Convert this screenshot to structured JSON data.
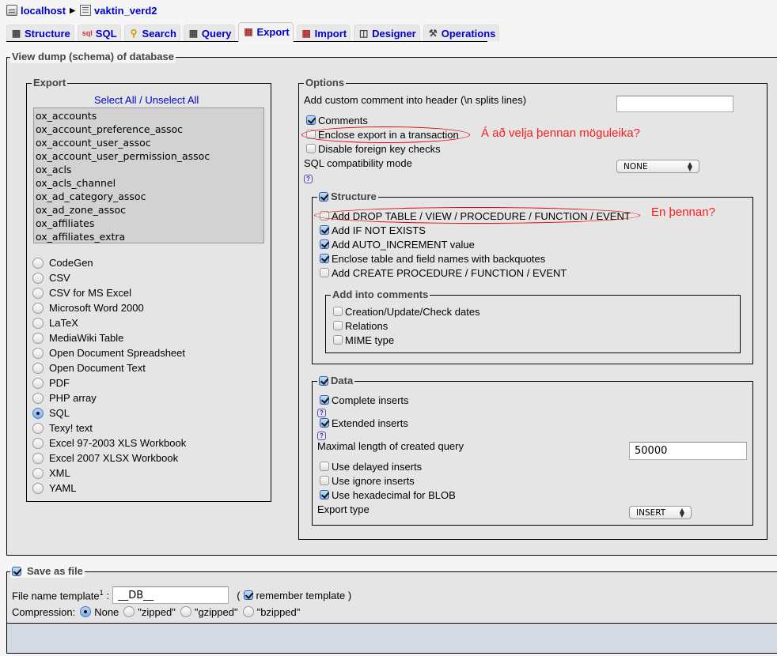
{
  "breadcrumb": {
    "server": "localhost",
    "database": "vaktin_verd2"
  },
  "tabs": [
    {
      "label": "Structure",
      "icon": "structure-icon",
      "active": false
    },
    {
      "label": "SQL",
      "icon": "sql-icon",
      "active": false
    },
    {
      "label": "Search",
      "icon": "search-icon",
      "active": false
    },
    {
      "label": "Query",
      "icon": "query-icon",
      "active": false
    },
    {
      "label": "Export",
      "icon": "export-icon",
      "active": true
    },
    {
      "label": "Import",
      "icon": "import-icon",
      "active": false
    },
    {
      "label": "Designer",
      "icon": "designer-icon",
      "active": false
    },
    {
      "label": "Operations",
      "icon": "operations-icon",
      "active": false
    }
  ],
  "main": {
    "legend": "View dump (schema) of database",
    "export": {
      "legend": "Export",
      "select_all": "Select All",
      "separator": "/",
      "unselect_all": "Unselect All",
      "tables": [
        "ox_accounts",
        "ox_account_preference_assoc",
        "ox_account_user_assoc",
        "ox_account_user_permission_assoc",
        "ox_acls",
        "ox_acls_channel",
        "ox_ad_category_assoc",
        "ox_ad_zone_assoc",
        "ox_affiliates",
        "ox_affiliates_extra"
      ],
      "formats": [
        {
          "label": "CodeGen",
          "selected": false
        },
        {
          "label": "CSV",
          "selected": false
        },
        {
          "label": "CSV for MS Excel",
          "selected": false
        },
        {
          "label": "Microsoft Word 2000",
          "selected": false
        },
        {
          "label": "LaTeX",
          "selected": false
        },
        {
          "label": "MediaWiki Table",
          "selected": false
        },
        {
          "label": "Open Document Spreadsheet",
          "selected": false
        },
        {
          "label": "Open Document Text",
          "selected": false
        },
        {
          "label": "PDF",
          "selected": false
        },
        {
          "label": "PHP array",
          "selected": false
        },
        {
          "label": "SQL",
          "selected": true
        },
        {
          "label": "Texy! text",
          "selected": false
        },
        {
          "label": "Excel 97-2003 XLS Workbook",
          "selected": false
        },
        {
          "label": "Excel 2007 XLSX Workbook",
          "selected": false
        },
        {
          "label": "XML",
          "selected": false
        },
        {
          "label": "YAML",
          "selected": false
        }
      ]
    },
    "options": {
      "legend": "Options",
      "custom_comment_label": "Add custom comment into header (\\n splits lines)",
      "custom_comment_value": "",
      "comments": {
        "label": "Comments",
        "checked": true
      },
      "transaction": {
        "label": "Enclose export in a transaction",
        "checked": false
      },
      "disable_fk": {
        "label": "Disable foreign key checks",
        "checked": false
      },
      "compat_label": "SQL compatibility mode",
      "compat_value": "NONE",
      "structure": {
        "legend": "Structure",
        "checked": true,
        "items": [
          {
            "label": "Add DROP TABLE / VIEW / PROCEDURE / FUNCTION / EVENT",
            "checked": false
          },
          {
            "label": "Add IF NOT EXISTS",
            "checked": true
          },
          {
            "label": "Add AUTO_INCREMENT value",
            "checked": true
          },
          {
            "label": "Enclose table and field names with backquotes",
            "checked": true
          },
          {
            "label": "Add CREATE PROCEDURE / FUNCTION / EVENT",
            "checked": false
          }
        ],
        "comments": {
          "legend": "Add into comments",
          "items": [
            {
              "label": "Creation/Update/Check dates",
              "checked": false
            },
            {
              "label": "Relations",
              "checked": false
            },
            {
              "label": "MIME type",
              "checked": false
            }
          ]
        }
      },
      "data": {
        "legend": "Data",
        "checked": true,
        "complete_inserts": {
          "label": "Complete inserts",
          "checked": true
        },
        "extended_inserts": {
          "label": "Extended inserts",
          "checked": true
        },
        "max_length_label": "Maximal length of created query",
        "max_length_value": "50000",
        "delayed": {
          "label": "Use delayed inserts",
          "checked": false
        },
        "ignore": {
          "label": "Use ignore inserts",
          "checked": false
        },
        "hex_blob": {
          "label": "Use hexadecimal for BLOB",
          "checked": true
        },
        "export_type_label": "Export type",
        "export_type_value": "INSERT"
      }
    }
  },
  "save_as_file": {
    "legend": "Save as file",
    "checked": true,
    "filename_label": "File name template",
    "filename_sup": "1",
    "filename_colon": ":",
    "filename_value": "__DB__",
    "paren_open": "(",
    "remember_label": "remember template )",
    "remember_checked": true,
    "compression_label": "Compression:",
    "compression_options": [
      {
        "label": "None",
        "selected": true
      },
      {
        "label": "\"zipped\"",
        "selected": false
      },
      {
        "label": "\"gzipped\"",
        "selected": false
      },
      {
        "label": "\"bzipped\"",
        "selected": false
      }
    ]
  },
  "annotations": {
    "transaction_question": "Á að velja þennan möguleika?",
    "drop_question": "En þennan?",
    "color": "#ff1a1a"
  },
  "help_icon": "?"
}
